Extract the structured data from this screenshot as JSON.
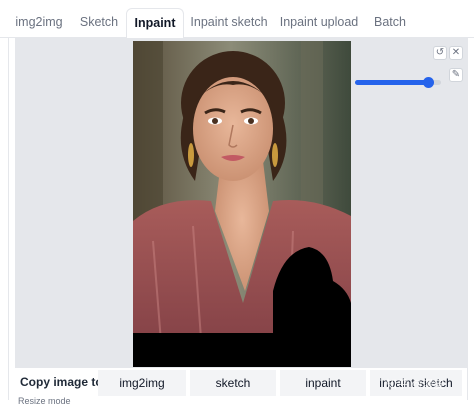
{
  "tabs": [
    "img2img",
    "Sketch",
    "Inpaint",
    "Inpaint sketch",
    "Inpaint upload",
    "Batch"
  ],
  "active_tab": "Inpaint",
  "editor": {
    "undo_icon": "undo-icon",
    "close_icon": "close-icon",
    "brush_icon": "brush-icon",
    "brush_size_fraction": 0.85,
    "accent_color": "#2563eb"
  },
  "copy_image": {
    "label": "Copy image to:",
    "targets": [
      "img2img",
      "sketch",
      "inpaint",
      "inpaint sketch"
    ]
  },
  "resize_mode_label": "Resize mode",
  "watermark": "知乎 @漫皮"
}
